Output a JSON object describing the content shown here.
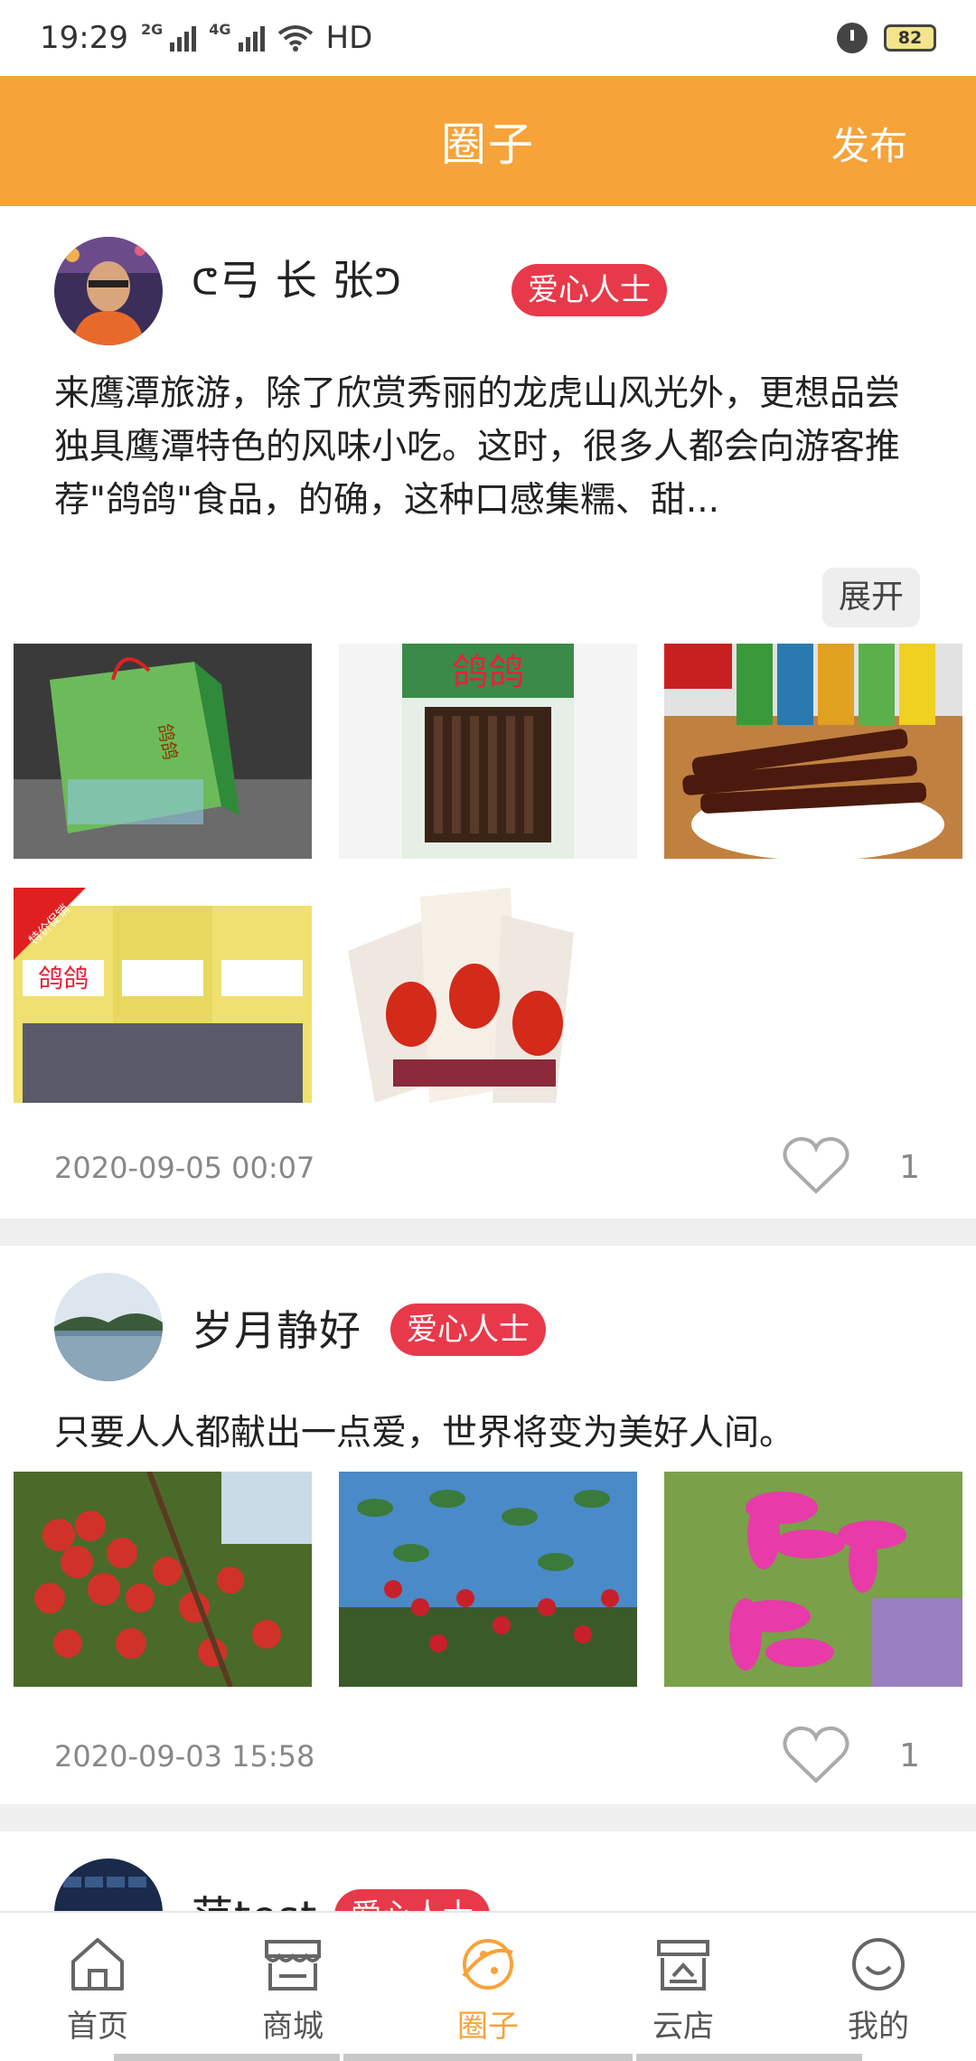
{
  "status_bar": {
    "time": "19:29",
    "net1": "2G",
    "net2": "4G",
    "hd": "HD",
    "battery": "82"
  },
  "header": {
    "title": "圈子",
    "publish_label": "发布",
    "color": "#f6a33a"
  },
  "posts": [
    {
      "username": "弓 长 张",
      "badge": "爱心人士",
      "content": "来鹰潭旅游，除了欣赏秀丽的龙虎山风光外，更想品尝独具鹰潭特色的风味小吃。这时，很多人都会向游客推荐\"鸽鸽\"食品，的确，这种口感集糯、甜...",
      "expand_label": "展开",
      "images": [
        "gift-bag-photo",
        "jerky-package-photo",
        "jerky-sticks-photo",
        "pineapple-jerky-photo",
        "spicy-jerky-packs-photo"
      ],
      "image_texts": [
        "鸽鸽",
        "特价促销"
      ],
      "timestamp": "2020-09-05 00:07",
      "likes": "1"
    },
    {
      "username": "岁月静好",
      "badge": "爱心人士",
      "content": "只要人人都献出一点爱，世界将变为美好人间。",
      "images": [
        "red-berries-photo",
        "berry-branch-photo",
        "pink-flowers-photo"
      ],
      "timestamp": "2020-09-03 15:58",
      "likes": "1"
    },
    {
      "username": "范test",
      "badge": "爱心人士"
    }
  ],
  "tabs": [
    {
      "label": "首页",
      "icon": "home-icon",
      "active": false
    },
    {
      "label": "商城",
      "icon": "store-icon",
      "active": false
    },
    {
      "label": "圈子",
      "icon": "circle-icon",
      "active": true
    },
    {
      "label": "云店",
      "icon": "cloud-shop-icon",
      "active": false
    },
    {
      "label": "我的",
      "icon": "profile-icon",
      "active": false
    }
  ]
}
